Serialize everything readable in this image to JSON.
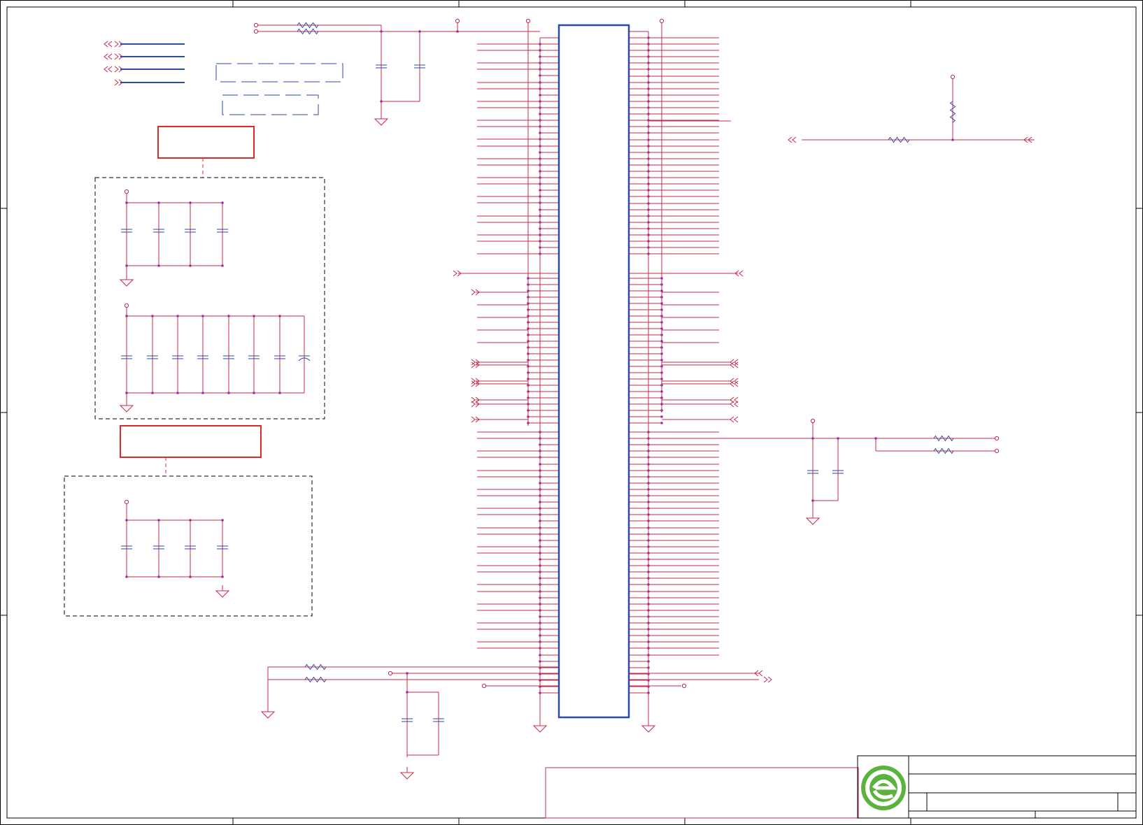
{
  "schematic": {
    "sheet_size": "1634x1180",
    "colors": {
      "wire": "#c8284a",
      "component": "#2b4aa8",
      "frame": "#000000",
      "highlight_box": "#e02828",
      "logo_green": "#5bb33d"
    },
    "icons": {
      "logo": "green-e-logo-icon",
      "ground": "ground-icon",
      "resistor": "resistor-icon",
      "capacitor": "capacitor-icon",
      "off_page": "off-page-connector-icon",
      "power": "power-pin-icon"
    }
  }
}
